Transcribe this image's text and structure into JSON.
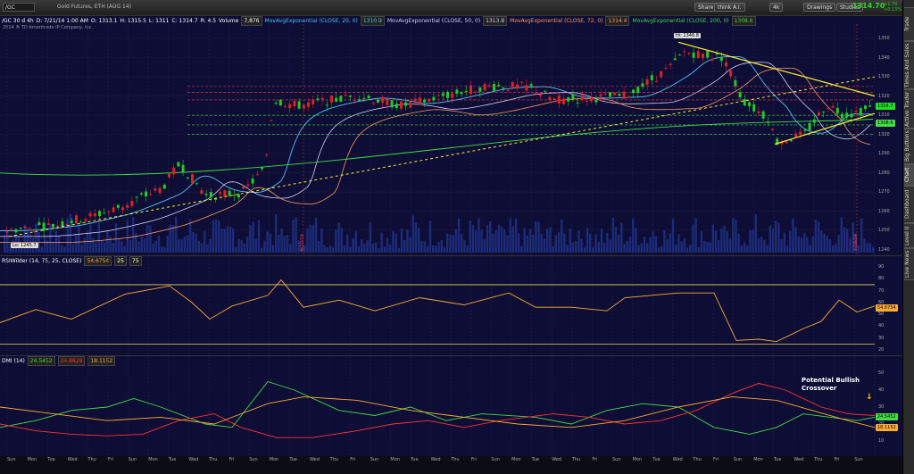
{
  "toolbar": {
    "symbol": "/GC",
    "description": "Gold Futures, ETH (AUG 14)",
    "buttons": [
      "Share",
      "think A.I.",
      "4k",
      "Drawings",
      "Studies"
    ],
    "last_price": "1314.70",
    "change_lines": [
      "+1.70",
      "+0.13%"
    ]
  },
  "sidebar": {
    "tabs": [
      "Trade",
      "Times And Sales",
      "Active Trader",
      "Big Buttons",
      "Chart",
      "Dashboard",
      "Level II",
      "Live News"
    ],
    "active": "Chart"
  },
  "price_pane": {
    "header": [
      {
        "text": "/GC 30 d 4h",
        "color": "#ffffff"
      },
      {
        "text": "D: 7/21/14 1:00 AM",
        "color": "#ffffff"
      },
      {
        "text": "O: 1313.1",
        "color": "#ffffff"
      },
      {
        "text": "H: 1315.5",
        "color": "#ffffff"
      },
      {
        "text": "L: 1311",
        "color": "#ffffff"
      },
      {
        "text": "C: 1314.7",
        "color": "#ffffff"
      },
      {
        "text": "R: 4.5",
        "color": "#ffffff"
      },
      {
        "text": "Volume",
        "color": "#ffffff"
      },
      {
        "text": "7,876",
        "color": "#ffffff",
        "box": true
      },
      {
        "text": "MovAvgExponential (CLOSE, 20, 0)",
        "color": "#4fc3f7"
      },
      {
        "text": "1310.9",
        "color": "#4fc3f7",
        "box": true
      },
      {
        "text": "MovAvgExponential (CLOSE, 50, 0)",
        "color": "#d0d0ff"
      },
      {
        "text": "1313.8",
        "color": "#d0d0ff",
        "box": true
      },
      {
        "text": "MovAvgExponential (CLOSE, 72, 0)",
        "color": "#ff9966"
      },
      {
        "text": "1314.4",
        "color": "#ff9966",
        "box": true
      },
      {
        "text": "MovAvgExponential (CLOSE, 200, 0)",
        "color": "#44dd44"
      },
      {
        "text": "1308.6",
        "color": "#44dd44",
        "box": true
      }
    ],
    "copyright": "2014 ® TD Ameritrade IP Company, Inc.",
    "y_ticks": [
      "1350",
      "1340",
      "1330",
      "1320",
      "1310",
      "1300",
      "1290",
      "1280",
      "1270",
      "1260",
      "1250",
      "1240"
    ],
    "flags": [
      {
        "text": "1314.7",
        "color": "#22dd22"
      },
      {
        "text": "1308.6",
        "color": "#44dd44"
      }
    ],
    "hi_label": "Hi: 1346.8",
    "lo_label": "Lo: 1245.7",
    "date_markers": [
      "6/20/14",
      "7/18/14"
    ]
  },
  "rsi_pane": {
    "header": [
      {
        "text": "RSIWilder (14, 75, 25, CLOSE)",
        "color": "#ffffff"
      },
      {
        "text": "54.6754",
        "color": "#ffaa33",
        "box": true
      },
      {
        "text": "25",
        "color": "#ffffff",
        "box": true
      },
      {
        "text": "75",
        "color": "#ffffff",
        "box": true
      }
    ],
    "y_ticks": [
      "90",
      "80",
      "70",
      "60",
      "50",
      "40",
      "30",
      "20"
    ],
    "flag": {
      "text": "54.6754",
      "color": "#ffaa33"
    }
  },
  "dmi_pane": {
    "header": [
      {
        "text": "DMI (14)",
        "color": "#ffffff"
      },
      {
        "text": "24.5452",
        "color": "#44dd44",
        "box": true
      },
      {
        "text": "24.8829",
        "color": "#ff3333",
        "box": true
      },
      {
        "text": "18.1152",
        "color": "#ffaa33",
        "box": true
      }
    ],
    "y_ticks": [
      "50",
      "40",
      "30",
      "20",
      "10"
    ],
    "flags": [
      {
        "text": "24.5452",
        "color": "#44dd44"
      },
      {
        "text": "18.1152",
        "color": "#ffaa33"
      }
    ],
    "note": [
      "Potential Bullish",
      "Crossover"
    ]
  },
  "x_axis": {
    "labels": [
      "Sun",
      "Mon",
      "Tue",
      "Wed",
      "Thu",
      "Fri",
      "Sun",
      "Mon",
      "Tue",
      "Wed",
      "Thu",
      "Fri",
      "Sun",
      "Mon",
      "Tue",
      "Wed",
      "Thu",
      "Fri",
      "Sun",
      "Mon",
      "Tue",
      "Wed",
      "Thu",
      "Fri",
      "Sun",
      "Mon",
      "Tue",
      "Wed",
      "Thu",
      "Fri",
      "Sun",
      "Mon",
      "Tue",
      "Wed",
      "Thu",
      "Fri",
      "Sun",
      "Mon",
      "Tue",
      "Wed",
      "Thu",
      "Fri",
      "Sun"
    ]
  },
  "colors": {
    "background": "#0d0d35",
    "up_candle": "#22cc22",
    "down_candle": "#dd2222",
    "trendline": "#ffee33",
    "volume": "#1c2c7a"
  }
}
